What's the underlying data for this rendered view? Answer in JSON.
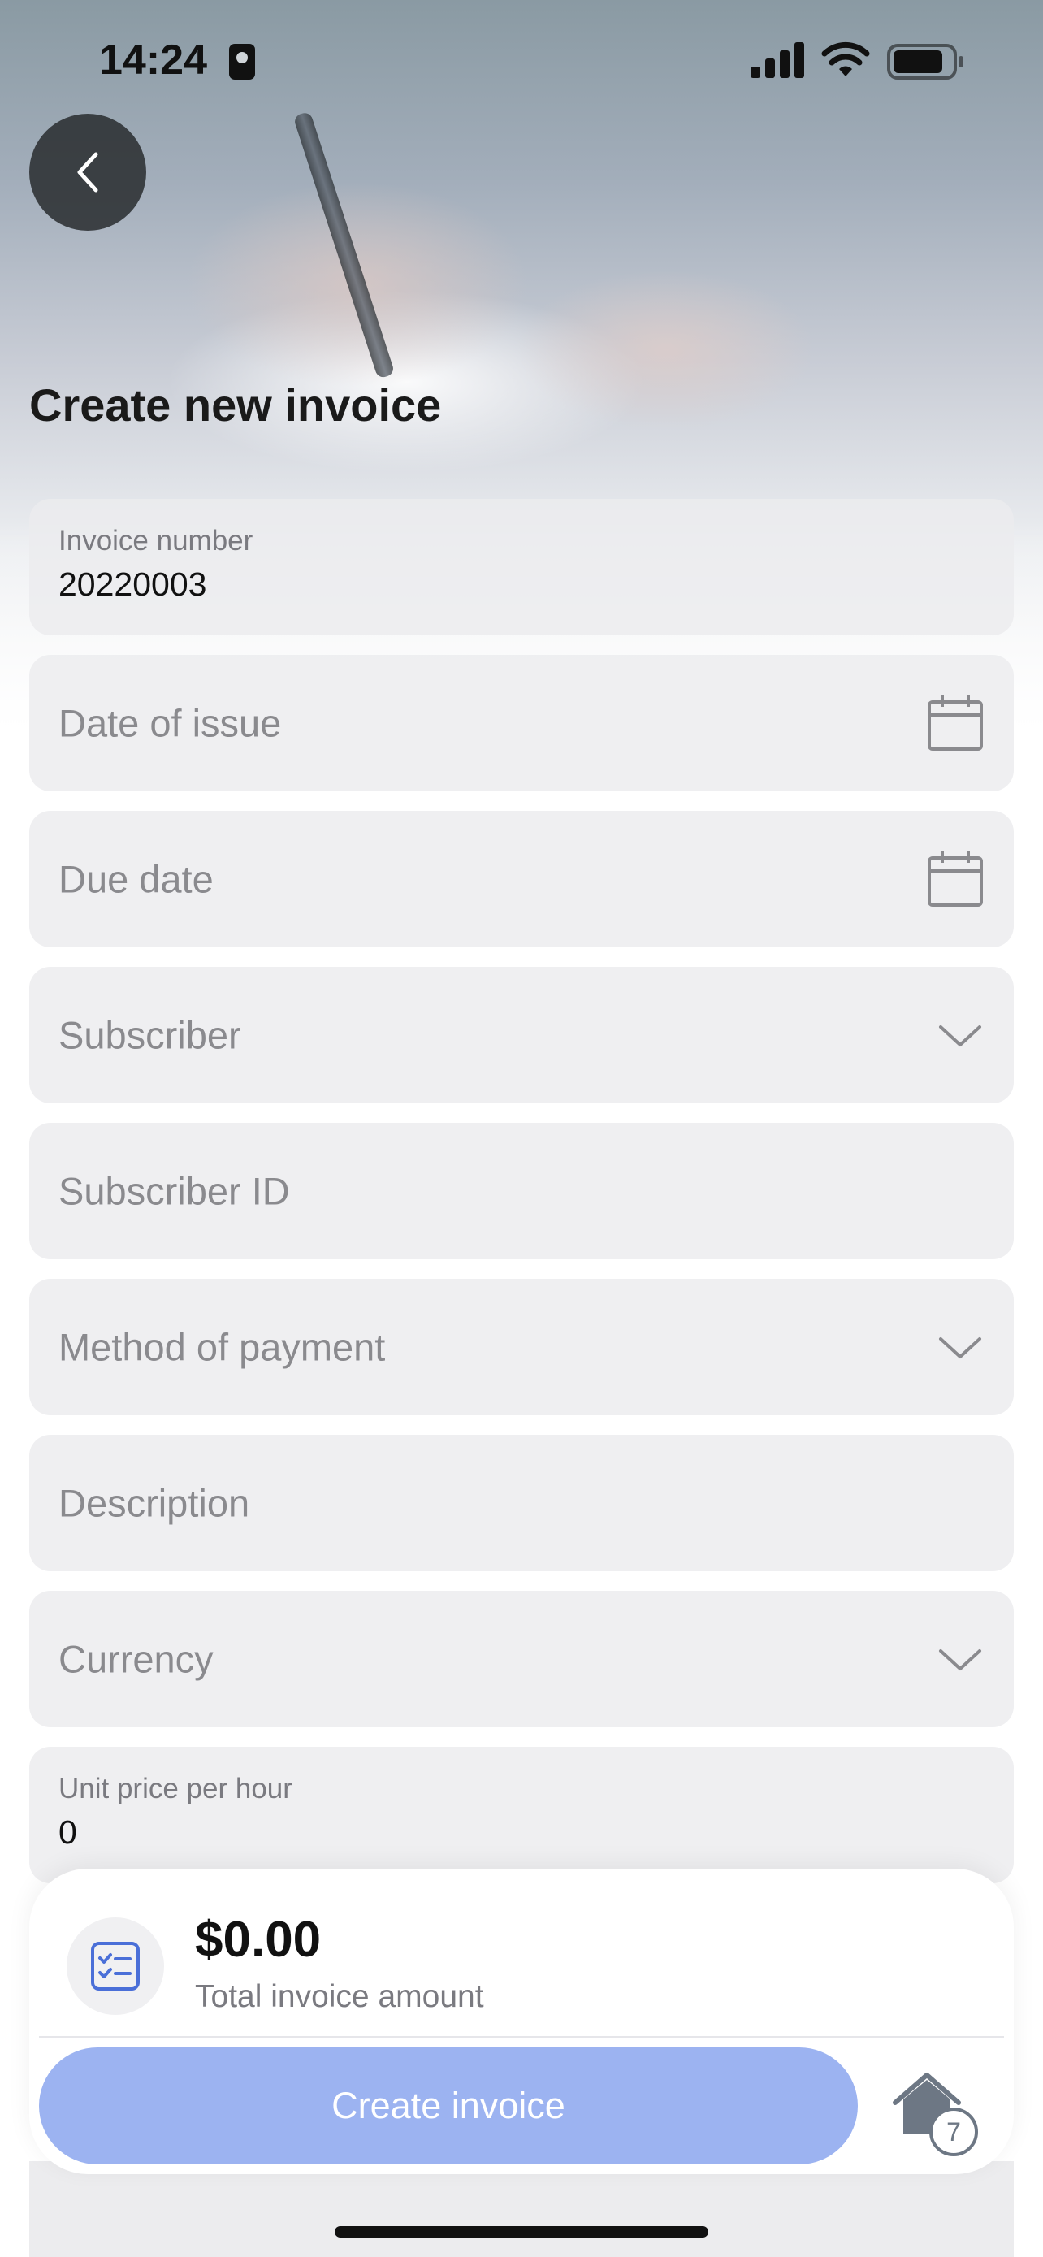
{
  "status_bar": {
    "time": "14:24"
  },
  "page": {
    "title": "Create new invoice"
  },
  "form": {
    "invoice_number": {
      "label": "Invoice number",
      "value": "20220003"
    },
    "date_of_issue": {
      "placeholder": "Date of issue",
      "icon": "calendar-icon"
    },
    "due_date": {
      "placeholder": "Due date",
      "icon": "calendar-icon"
    },
    "subscriber": {
      "placeholder": "Subscriber",
      "icon": "chevron-down-icon"
    },
    "subscriber_id": {
      "placeholder": "Subscriber ID"
    },
    "method_of_payment": {
      "placeholder": "Method of payment",
      "icon": "chevron-down-icon"
    },
    "description": {
      "placeholder": "Description"
    },
    "currency": {
      "placeholder": "Currency",
      "icon": "chevron-down-icon"
    },
    "unit_price": {
      "label": "Unit price per hour",
      "value": "0"
    }
  },
  "summary": {
    "amount": "$0.00",
    "amount_label": "Total invoice amount",
    "create_button": "Create invoice",
    "home_badge": "7"
  },
  "colors": {
    "primary_button": "#9cb3f1",
    "field_bg": "#ececee",
    "accent_icon": "#4a6fd8"
  }
}
